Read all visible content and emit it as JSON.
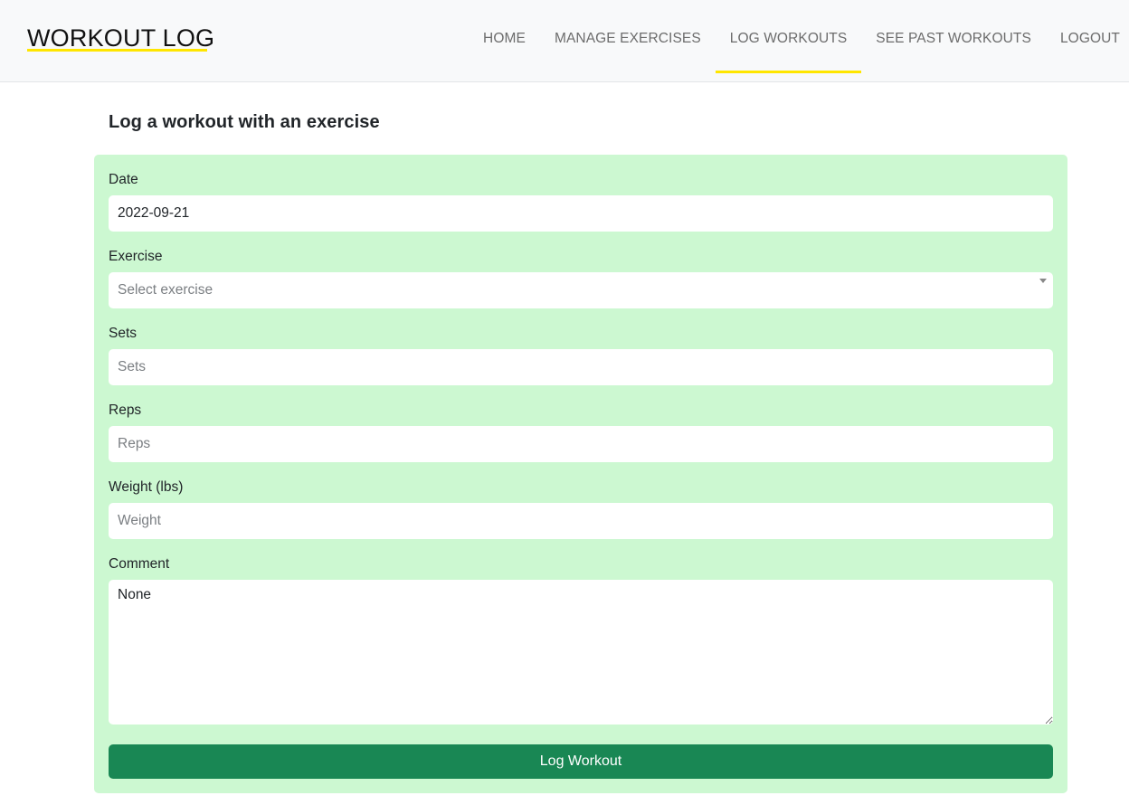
{
  "brand": {
    "title": "WORKOUT LOG",
    "underline_color": "#ffe600"
  },
  "nav": {
    "items": [
      {
        "label": "HOME",
        "active": false
      },
      {
        "label": "MANAGE EXERCISES",
        "active": false
      },
      {
        "label": "LOG WORKOUTS",
        "active": true
      },
      {
        "label": "SEE PAST WORKOUTS",
        "active": false
      },
      {
        "label": "LOGOUT",
        "active": false
      }
    ]
  },
  "page": {
    "heading": "Log a workout with an exercise"
  },
  "form": {
    "background_color": "#ccf8d1",
    "date": {
      "label": "Date",
      "value": "2022-09-21"
    },
    "exercise": {
      "label": "Exercise",
      "placeholder": "Select exercise",
      "icon": "caret-down-icon"
    },
    "sets": {
      "label": "Sets",
      "placeholder": "Sets",
      "value": ""
    },
    "reps": {
      "label": "Reps",
      "placeholder": "Reps",
      "value": ""
    },
    "weight": {
      "label": "Weight (lbs)",
      "placeholder": "Weight",
      "value": ""
    },
    "comment": {
      "label": "Comment",
      "value": "None"
    },
    "submit": {
      "label": "Log Workout",
      "color": "#198754"
    }
  }
}
